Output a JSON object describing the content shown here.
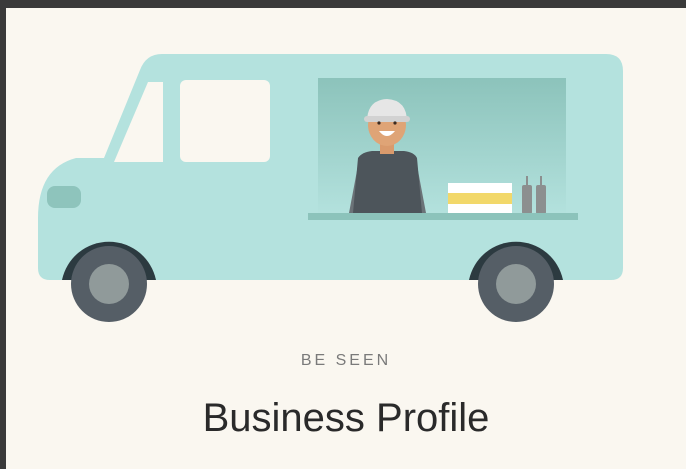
{
  "hero": {
    "image_name": "food-truck-illustration",
    "eyebrow": "BE SEEN",
    "title": "Business Profile"
  },
  "colors": {
    "background": "#faf7f0",
    "truck_body": "#b4e2de",
    "truck_window_dark": "#8fc2ba",
    "wheel_outer": "#555e66",
    "wheel_inner": "#909a9a",
    "eyebrow_text": "#7a7a7a",
    "title_text": "#2a2a2a"
  }
}
